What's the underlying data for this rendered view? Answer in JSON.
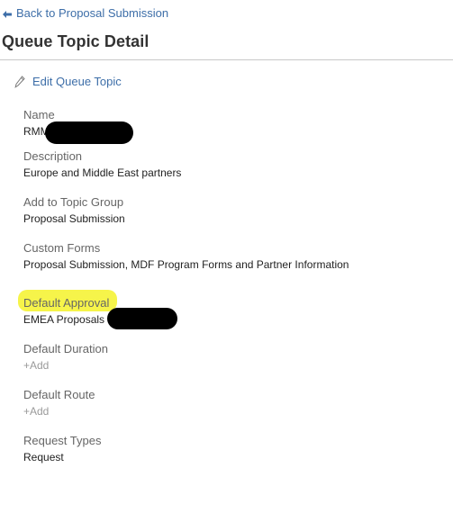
{
  "nav": {
    "back_label": "Back to Proposal Submission",
    "back_icon": "arrow-left-icon"
  },
  "page": {
    "title": "Queue Topic Detail"
  },
  "actions": {
    "edit_label": "Edit Queue Topic",
    "edit_icon": "pencil-icon"
  },
  "fields": {
    "name": {
      "label": "Name",
      "value": "RMM"
    },
    "description": {
      "label": "Description",
      "value": "Europe and Middle East partners"
    },
    "topic_group": {
      "label": "Add to Topic Group",
      "value": "Proposal Submission"
    },
    "custom_forms": {
      "label": "Custom Forms",
      "value": "Proposal Submission, MDF Program Forms and Partner Information"
    },
    "default_approval": {
      "label": "Default Approval",
      "value": "EMEA Proposals"
    },
    "default_duration": {
      "label": "Default Duration",
      "add": "+Add"
    },
    "default_route": {
      "label": "Default Route",
      "add": "+Add"
    },
    "request_types": {
      "label": "Request Types",
      "value": "Request"
    }
  },
  "colors": {
    "link": "#3d6ea8",
    "label": "#666666",
    "value": "#222222",
    "placeholder": "#9a9a9a",
    "highlight": "#f4f22a",
    "redaction": "#000000"
  }
}
